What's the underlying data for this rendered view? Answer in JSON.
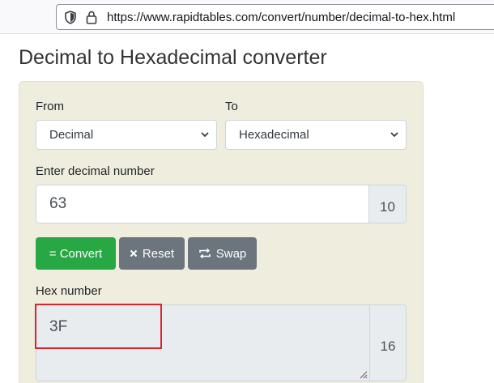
{
  "browser": {
    "url": "https://www.rapidtables.com/convert/number/decimal-to-hex.html",
    "icons": [
      "shield-icon",
      "lock-icon"
    ]
  },
  "page": {
    "title": "Decimal to Hexadecimal converter"
  },
  "converter": {
    "from_label": "From",
    "from_value": "Decimal",
    "to_label": "To",
    "to_value": "Hexadecimal",
    "input_label": "Enter decimal number",
    "input_value": "63",
    "input_base": "10",
    "buttons": {
      "convert": "= Convert",
      "reset": "Reset",
      "swap": "Swap"
    },
    "output_label": "Hex number",
    "output_value": "3F",
    "output_base": "16"
  },
  "colors": {
    "convert": "#28a745",
    "secondary": "#6c757d",
    "panel": "#efeddd",
    "highlight": "#d7262e"
  }
}
